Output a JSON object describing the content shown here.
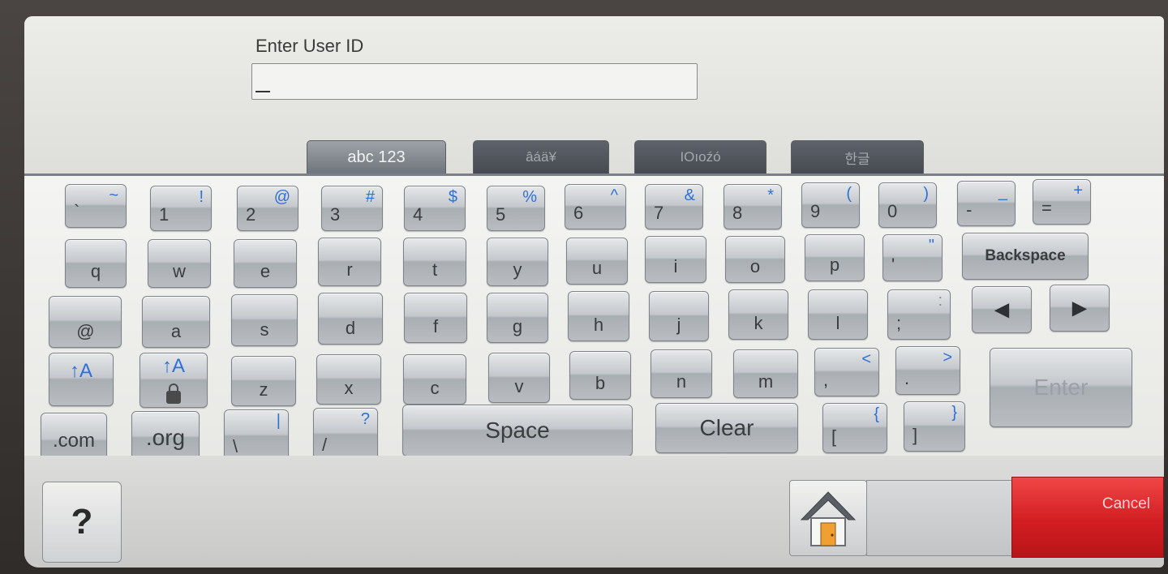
{
  "header": {
    "prompt": "Enter User ID",
    "input_value": ""
  },
  "tabs": [
    {
      "label": "abc 123",
      "active": true
    },
    {
      "label": "âáä¥",
      "active": false
    },
    {
      "label": "IOıoźó",
      "active": false
    },
    {
      "label": "한글",
      "active": false
    }
  ],
  "keys": {
    "row1": [
      {
        "main": "`",
        "sub": "~"
      },
      {
        "main": "1",
        "sub": "!"
      },
      {
        "main": "2",
        "sub": "@"
      },
      {
        "main": "3",
        "sub": "#"
      },
      {
        "main": "4",
        "sub": "$"
      },
      {
        "main": "5",
        "sub": "%"
      },
      {
        "main": "6",
        "sub": "^"
      },
      {
        "main": "7",
        "sub": "&"
      },
      {
        "main": "8",
        "sub": "*"
      },
      {
        "main": "9",
        "sub": "("
      },
      {
        "main": "0",
        "sub": ")"
      },
      {
        "main": "-",
        "sub": "_"
      },
      {
        "main": "=",
        "sub": "+"
      }
    ],
    "row2": [
      "q",
      "w",
      "e",
      "r",
      "t",
      "y",
      "u",
      "i",
      "o",
      "p"
    ],
    "row2_quote": {
      "main": "'",
      "sub": "\""
    },
    "backspace": "Backspace",
    "row3": [
      "@",
      "a",
      "s",
      "d",
      "f",
      "g",
      "h",
      "j",
      "k",
      "l"
    ],
    "row3_semicolon": {
      "main": ";",
      "sub": ":"
    },
    "left_arrow": "◀",
    "right_arrow": "▶",
    "shift": "↑A",
    "caps_lock": "↑A",
    "row4": [
      "z",
      "x",
      "c",
      "v",
      "b",
      "n",
      "m"
    ],
    "comma": {
      "main": ",",
      "sub": "<"
    },
    "period": {
      "main": ".",
      "sub": ">"
    },
    "enter": "Enter",
    "dot_com": ".com",
    "dot_org": ".org",
    "backslash": {
      "main": "\\",
      "sub": "|"
    },
    "slash": {
      "main": "/",
      "sub": "?"
    },
    "space": "Space",
    "clear": "Clear",
    "open_bracket": {
      "main": "[",
      "sub": "{"
    },
    "close_bracket": {
      "main": "]",
      "sub": "}"
    }
  },
  "bottom": {
    "help": "?",
    "cancel": "Cancel"
  },
  "colors": {
    "accent_blue": "#2f6fd8",
    "cancel_red": "#d21e22"
  }
}
